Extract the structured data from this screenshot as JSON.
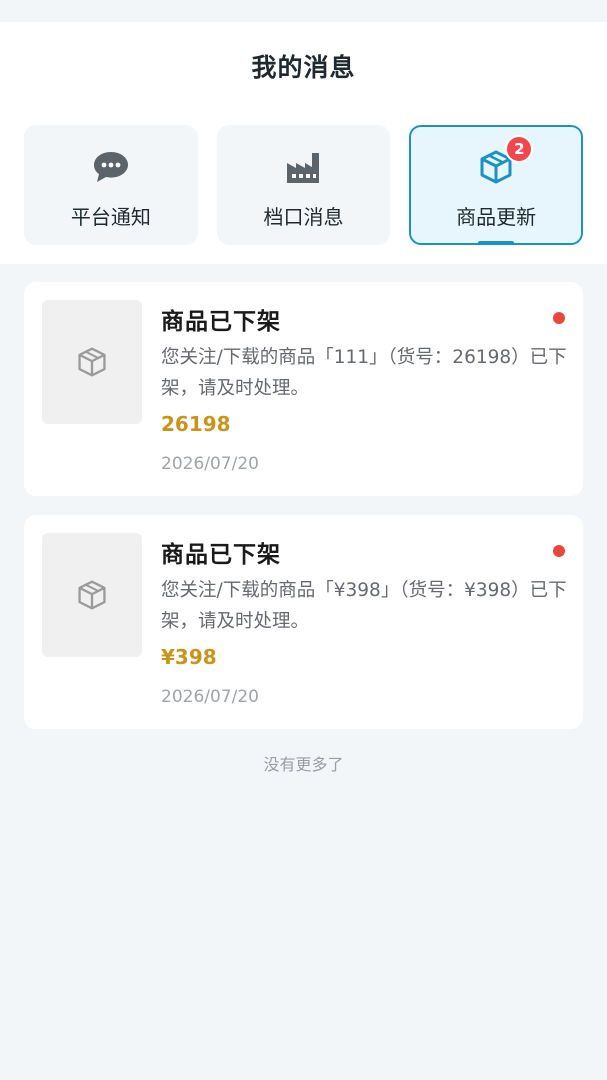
{
  "page": {
    "title": "我的消息"
  },
  "tabs": [
    {
      "label": "平台通知",
      "icon": "chat-bubble-icon",
      "active": false
    },
    {
      "label": "档口消息",
      "icon": "factory-icon",
      "active": false
    },
    {
      "label": "商品更新",
      "icon": "package-box-icon",
      "active": true,
      "badge": "2"
    }
  ],
  "messages": [
    {
      "title": "商品已下架",
      "description": "您关注/下载的商品「111」（货号：26198）已下架，请及时处理。",
      "code": "26198",
      "date": "2026/07/20",
      "unread": true
    },
    {
      "title": "商品已下架",
      "description": "您关注/下载的商品「¥398」（货号：¥398）已下架，请及时处理。",
      "code": "¥398",
      "date": "2026/07/20",
      "unread": true
    }
  ],
  "footer": {
    "no_more": "没有更多了"
  },
  "colors": {
    "accent": "#1d92c2",
    "badge": "#f0484e",
    "unread_dot": "#e8473b",
    "code": "#c9941a",
    "icon_gray": "#5b646b"
  }
}
